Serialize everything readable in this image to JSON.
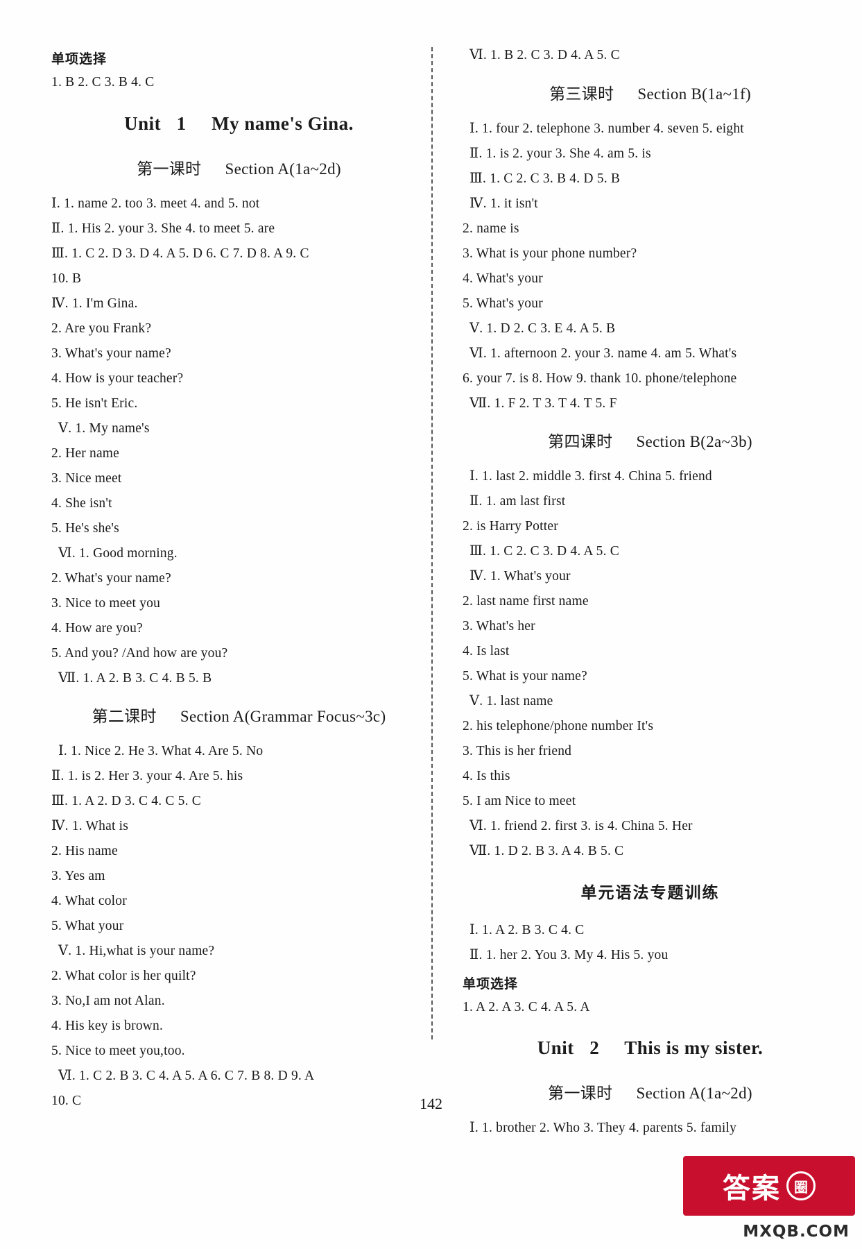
{
  "page": {
    "number": "142",
    "brand_text": "答案",
    "brand_circle": "圈",
    "brand_url": "MXQB.COM"
  },
  "left_column": {
    "top_heading": "单项选择",
    "top_answers": "1. B   2. C   3. B   4. C",
    "unit": {
      "label": "Unit",
      "number": "1",
      "title": "My name's Gina."
    },
    "lesson1": {
      "cn": "第一课时",
      "en": "Section A(1a~2d)"
    },
    "lesson1_lines": [
      "Ⅰ. 1. name   2. too   3. meet   4. and   5. not",
      "Ⅱ. 1. His   2. your   3. She   4. to meet   5. are",
      "Ⅲ. 1. C   2. D   3. D   4. A   5. D   6. C   7. D   8. A   9. C",
      "10. B",
      "Ⅳ. 1. I'm Gina.",
      "2. Are you Frank?",
      "3. What's your name?",
      "4. How is your teacher?",
      "5. He isn't Eric.",
      "Ⅴ. 1. My   name's",
      "2. Her   name",
      "3. Nice   meet",
      "4. She   isn't",
      "5. He's   she's",
      "Ⅵ. 1. Good morning.",
      "2. What's your name?",
      "3. Nice to meet you",
      "4. How are you?",
      "5. And you?  /And how are you?",
      "Ⅶ. 1. A   2. B   3. C   4. B   5. B"
    ],
    "lesson2": {
      "cn": "第二课时",
      "en": "Section A(Grammar Focus~3c)"
    },
    "lesson2_lines": [
      "Ⅰ. 1. Nice   2. He   3. What   4. Are   5. No",
      "Ⅱ. 1. is   2. Her   3. your   4. Are   5. his",
      "Ⅲ. 1. A   2. D   3. C   4. C   5. C",
      "Ⅳ. 1. What   is",
      "2. His   name",
      "3. Yes   am",
      "4. What   color",
      "5. What   your",
      "Ⅴ. 1. Hi,what is your name?",
      "2. What color is her quilt?",
      "3. No,I am not Alan.",
      "4. His key is brown.",
      "5. Nice to meet you,too.",
      "Ⅵ. 1. C   2. B   3. C   4. A   5. A   6. C   7. B   8. D   9. A",
      "10. C"
    ]
  },
  "right_column": {
    "carryover_line": "Ⅵ. 1. B   2. C   3. D   4. A   5. C",
    "lesson3": {
      "cn": "第三课时",
      "en": "Section B(1a~1f)"
    },
    "lesson3_lines": [
      "Ⅰ. 1. four   2. telephone   3. number   4. seven   5. eight",
      "Ⅱ. 1. is   2. your   3. She   4. am   5. is",
      "Ⅲ. 1. C   2. C   3. B   4. D   5. B",
      "Ⅳ. 1. it   isn't",
      "2. name   is",
      "3. What is your phone number?",
      "4. What's   your",
      "5. What's   your",
      "Ⅴ. 1. D   2. C   3. E   4. A   5. B",
      "Ⅵ. 1. afternoon   2. your   3. name   4. am   5. What's",
      "6. your   7. is   8. How   9. thank   10. phone/telephone",
      "Ⅶ. 1. F   2. T   3. T   4. T   5. F"
    ],
    "lesson4": {
      "cn": "第四课时",
      "en": "Section B(2a~3b)"
    },
    "lesson4_lines": [
      "Ⅰ. 1. last   2. middle   3. first   4. China   5. friend",
      "Ⅱ. 1. am   last   first",
      "2. is   Harry   Potter",
      "Ⅲ. 1. C   2. C   3. D   4. A   5. C",
      "Ⅳ. 1. What's   your",
      "2. last   name   first   name",
      "3. What's   her",
      "4. Is   last",
      "5. What is your name?",
      "Ⅴ. 1. last   name",
      "2. his   telephone/phone   number   It's",
      "3. This   is   her   friend",
      "4. Is   this",
      "5. I   am   Nice   to   meet",
      "Ⅵ. 1. friend   2. first   3. is   4. China   5. Her",
      "Ⅶ. 1. D   2. B   3. A   4. B   5. C"
    ],
    "grammar_title": "单元语法专题训练",
    "grammar_lines": [
      "Ⅰ. 1. A   2. B   3. C   4. C",
      "Ⅱ. 1. her   2. You   3. My   4. His   5. you"
    ],
    "choice_heading": "单项选择",
    "choice_answers": "1. A   2. A   3. C   4. A   5. A",
    "unit2": {
      "label": "Unit",
      "number": "2",
      "title": "This is my sister."
    },
    "lesson5": {
      "cn": "第一课时",
      "en": "Section A(1a~2d)"
    },
    "lesson5_lines": [
      "Ⅰ. 1. brother   2. Who   3. They   4. parents   5. family"
    ]
  }
}
